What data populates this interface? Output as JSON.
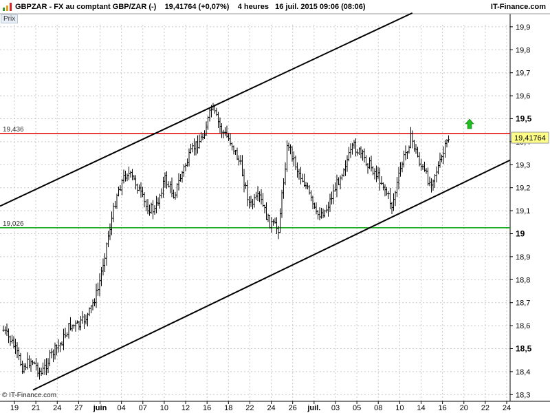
{
  "header": {
    "title": "GBPZAR - FX au comptant GBP/ZAR (-)",
    "quote": "19,41764 (+0,07%)",
    "period": "4 heures",
    "datetime": "16 juil. 2015 09:06 (08:06)",
    "brand": "IT-Finance.com"
  },
  "prix_label": "Prix",
  "watermark": "© IT-Finance.com",
  "colors": {
    "resistance": "#e00000",
    "support": "#00a000",
    "channel": "#000000",
    "grid": "#c8c8c8",
    "price_badge_bg": "#ffff88",
    "arrow": "#22bb22"
  },
  "chart_data": {
    "type": "ohlc",
    "instrument": "GBPZAR",
    "timeframe": "4 heures",
    "last_price": 19.41764,
    "last_price_label": "19,41764",
    "y_ticks": [
      "18,3",
      "18,4",
      "18,5",
      "18,6",
      "18,7",
      "18,8",
      "18,9",
      "19",
      "19,1",
      "19,2",
      "19,3",
      "19,4",
      "19,5",
      "19,6",
      "19,7",
      "19,8",
      "19,9"
    ],
    "y_tick_values": [
      18.3,
      18.4,
      18.5,
      18.6,
      18.7,
      18.8,
      18.9,
      19.0,
      19.1,
      19.2,
      19.3,
      19.4,
      19.5,
      19.6,
      19.7,
      19.8,
      19.9
    ],
    "ylim": [
      18.3,
      19.95
    ],
    "x_ticks": [
      "19",
      "21",
      "24",
      "27",
      "juin",
      "04",
      "07",
      "10",
      "12",
      "16",
      "18",
      "22",
      "24",
      "26",
      "juil.",
      "03",
      "05",
      "08",
      "10",
      "14",
      "16",
      "20",
      "22",
      "24"
    ],
    "hlines": [
      {
        "label": "19,436",
        "value": 19.436,
        "color": "#e00000"
      },
      {
        "label": "19,026",
        "value": 19.026,
        "color": "#00a000"
      }
    ],
    "channel_lines": [
      {
        "name": "upper",
        "from": {
          "x": "start",
          "y": 19.12
        },
        "to": {
          "x": "20 juil.",
          "y": 19.96
        }
      },
      {
        "name": "lower",
        "from": {
          "x": "19 mai",
          "y": 18.32
        },
        "to": {
          "x": "end",
          "y": 19.32
        }
      }
    ],
    "price_path": [
      {
        "date": "19 mai",
        "price": 18.58
      },
      {
        "date": "20 mai",
        "price": 18.52
      },
      {
        "date": "21 mai",
        "price": 18.42
      },
      {
        "date": "22 mai",
        "price": 18.45
      },
      {
        "date": "24 mai",
        "price": 18.39
      },
      {
        "date": "25 mai",
        "price": 18.47
      },
      {
        "date": "27 mai",
        "price": 18.52
      },
      {
        "date": "28 mai",
        "price": 18.6
      },
      {
        "date": "29 mai",
        "price": 18.6
      },
      {
        "date": "juin",
        "price": 18.65
      },
      {
        "date": "02 juin",
        "price": 18.76
      },
      {
        "date": "04 juin",
        "price": 18.98
      },
      {
        "date": "05 juin",
        "price": 19.18
      },
      {
        "date": "06 juin",
        "price": 19.27
      },
      {
        "date": "07 juin",
        "price": 19.22
      },
      {
        "date": "08 juin",
        "price": 19.12
      },
      {
        "date": "10 juin",
        "price": 19.1
      },
      {
        "date": "11 juin",
        "price": 19.24
      },
      {
        "date": "12 juin",
        "price": 19.17
      },
      {
        "date": "14 juin",
        "price": 19.28
      },
      {
        "date": "16 juin",
        "price": 19.37
      },
      {
        "date": "16 juin",
        "price": 19.42
      },
      {
        "date": "18 juin",
        "price": 19.55
      },
      {
        "date": "19 juin",
        "price": 19.45
      },
      {
        "date": "20 juin",
        "price": 19.4
      },
      {
        "date": "21 juin",
        "price": 19.3
      },
      {
        "date": "22 juin",
        "price": 19.12
      },
      {
        "date": "24 juin",
        "price": 19.16
      },
      {
        "date": "25 juin",
        "price": 19.05
      },
      {
        "date": "26 juin",
        "price": 19.02
      },
      {
        "date": "26 juin",
        "price": 19.4
      },
      {
        "date": "27 juin",
        "price": 19.28
      },
      {
        "date": "29 juin",
        "price": 19.2
      },
      {
        "date": "juil.",
        "price": 19.08
      },
      {
        "date": "02 juil.",
        "price": 19.1
      },
      {
        "date": "03 juil.",
        "price": 19.2
      },
      {
        "date": "05 juil.",
        "price": 19.3
      },
      {
        "date": "06 juil.",
        "price": 19.38
      },
      {
        "date": "07 juil.",
        "price": 19.33
      },
      {
        "date": "08 juil.",
        "price": 19.28
      },
      {
        "date": "09 juil.",
        "price": 19.22
      },
      {
        "date": "10 juil.",
        "price": 19.12
      },
      {
        "date": "11 juil.",
        "price": 19.3
      },
      {
        "date": "12 juil.",
        "price": 19.42
      },
      {
        "date": "13 juil.",
        "price": 19.3
      },
      {
        "date": "14 juil.",
        "price": 19.22
      },
      {
        "date": "15 juil.",
        "price": 19.3
      },
      {
        "date": "16 juil.",
        "price": 19.42
      }
    ]
  }
}
